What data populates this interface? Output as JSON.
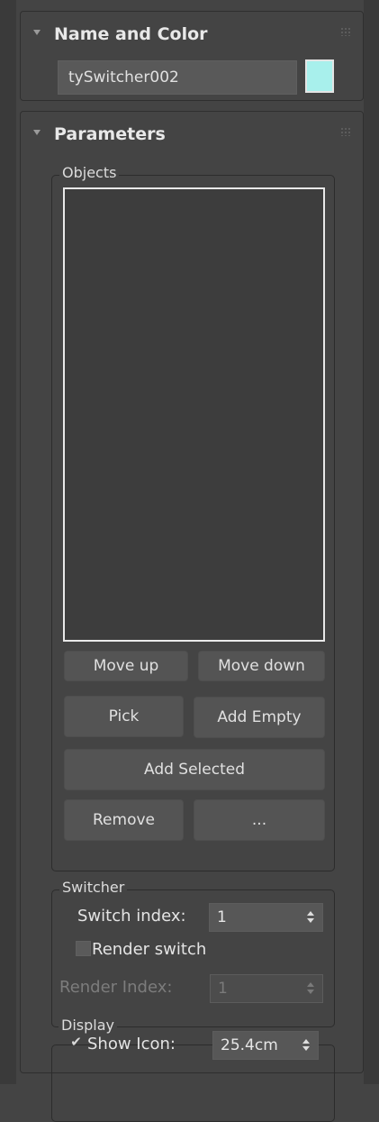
{
  "name_rollout": {
    "title": "Name and Color",
    "object_name": "tySwitcher002",
    "color": "#a8f0ec"
  },
  "parameters_rollout": {
    "title": "Parameters",
    "objects_group": {
      "label": "Objects",
      "items": [],
      "buttons": {
        "move_up": "Move up",
        "move_down": "Move down",
        "pick": "Pick",
        "add_empty": "Add Empty",
        "add_selected": "Add Selected",
        "remove": "Remove",
        "more": "..."
      }
    },
    "switcher_group": {
      "label": "Switcher",
      "switch_index_label": "Switch index:",
      "switch_index_value": "1",
      "render_switch_label": "Render switch",
      "render_switch_checked": false,
      "render_index_label": "Render Index:",
      "render_index_value": "1"
    },
    "display_group": {
      "label": "Display",
      "show_icon_label": "Show Icon:",
      "show_icon_checked": true,
      "show_icon_check_glyph": "✔",
      "icon_size_value": "25.4cm"
    }
  }
}
